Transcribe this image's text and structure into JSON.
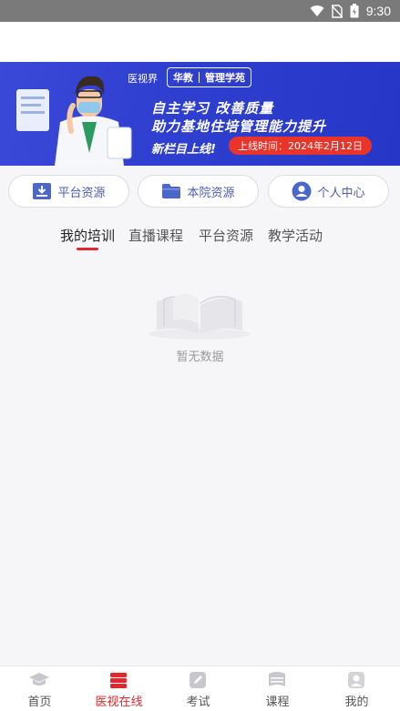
{
  "status_bar": {
    "time": "9:30"
  },
  "banner": {
    "logo_text": "医视界",
    "tag_left": "华教",
    "tag_right": "管理学苑",
    "headline_1": "自主学习 改善质量",
    "headline_2": "助力基地住培管理能力提升",
    "new_column": "新栏目上线!",
    "launch_pill": "上线时间：2024年2月12日"
  },
  "quick_links": [
    {
      "label": "平台资源",
      "icon": "download-tray-icon"
    },
    {
      "label": "本院资源",
      "icon": "folder-icon"
    },
    {
      "label": "个人中心",
      "icon": "user-icon"
    }
  ],
  "tabs": [
    {
      "label": "我的培训",
      "active": true
    },
    {
      "label": "直播课程",
      "active": false
    },
    {
      "label": "平台资源",
      "active": false
    },
    {
      "label": "教学活动",
      "active": false
    }
  ],
  "empty_state": {
    "text": "暂无数据",
    "icon": "open-book-icon"
  },
  "bottom_nav": [
    {
      "label": "首页",
      "icon": "graduation-cap-icon",
      "active": false
    },
    {
      "label": "医视在线",
      "icon": "stack-icon",
      "active": true
    },
    {
      "label": "考试",
      "icon": "pencil-square-icon",
      "active": false
    },
    {
      "label": "课程",
      "icon": "book-icon",
      "active": false
    },
    {
      "label": "我的",
      "icon": "profile-icon",
      "active": false
    }
  ],
  "colors": {
    "accent": "#e0282e",
    "link": "#4a5cb8",
    "banner_blue": "#2f3fd0",
    "pill_red": "#e8342b"
  }
}
